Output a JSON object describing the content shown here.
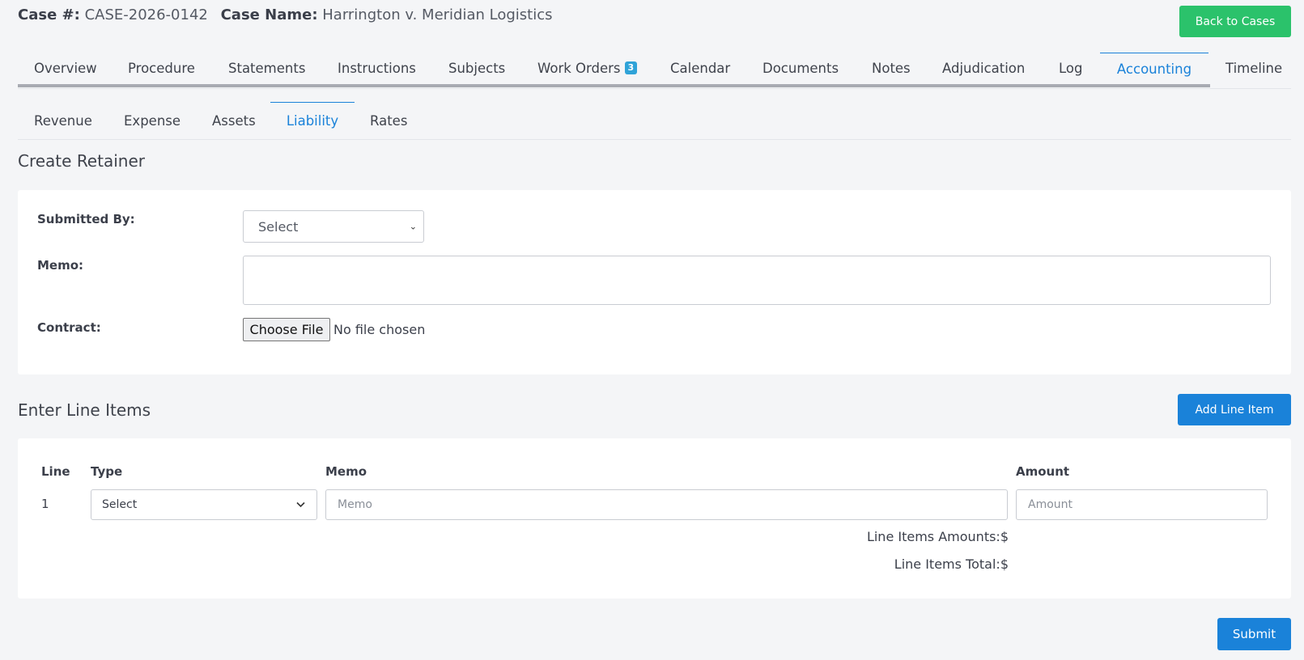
{
  "header": {
    "case_number_label": "Case #:",
    "case_number": "CASE-2026-0142",
    "case_name_label": "Case Name:",
    "case_name": "Harrington v. Meridian Logistics",
    "back_button": "Back to Cases"
  },
  "main_tabs": [
    {
      "label": "Overview"
    },
    {
      "label": "Procedure"
    },
    {
      "label": "Statements"
    },
    {
      "label": "Instructions"
    },
    {
      "label": "Subjects"
    },
    {
      "label": "Work Orders",
      "badge": "3"
    },
    {
      "label": "Calendar"
    },
    {
      "label": "Documents"
    },
    {
      "label": "Notes"
    },
    {
      "label": "Adjudication"
    },
    {
      "label": "Log"
    },
    {
      "label": "Accounting",
      "active": true
    },
    {
      "label": "Timeline"
    }
  ],
  "sub_tabs": [
    {
      "label": "Revenue"
    },
    {
      "label": "Expense"
    },
    {
      "label": "Assets"
    },
    {
      "label": "Liability",
      "active": true
    },
    {
      "label": "Rates"
    }
  ],
  "retainer": {
    "title": "Create Retainer",
    "submitted_by_label": "Submitted By:",
    "submitted_by_value": "Select",
    "memo_label": "Memo:",
    "contract_label": "Contract:",
    "file_button": "Choose File",
    "file_status": "No file chosen"
  },
  "line_items": {
    "title": "Enter Line Items",
    "add_button": "Add Line Item",
    "headers": {
      "line": "Line",
      "type": "Type",
      "memo": "Memo",
      "amount": "Amount"
    },
    "rows": [
      {
        "line": "1",
        "type": "Select",
        "memo_placeholder": "Memo",
        "amount_placeholder": "Amount"
      }
    ],
    "amounts_label": "Line Items Amounts:$",
    "total_label": "Line Items Total:$"
  },
  "submit_button": "Submit",
  "colors": {
    "primary": "#1a82d9",
    "success": "#2bc26b",
    "badge": "#2fa3d8"
  }
}
